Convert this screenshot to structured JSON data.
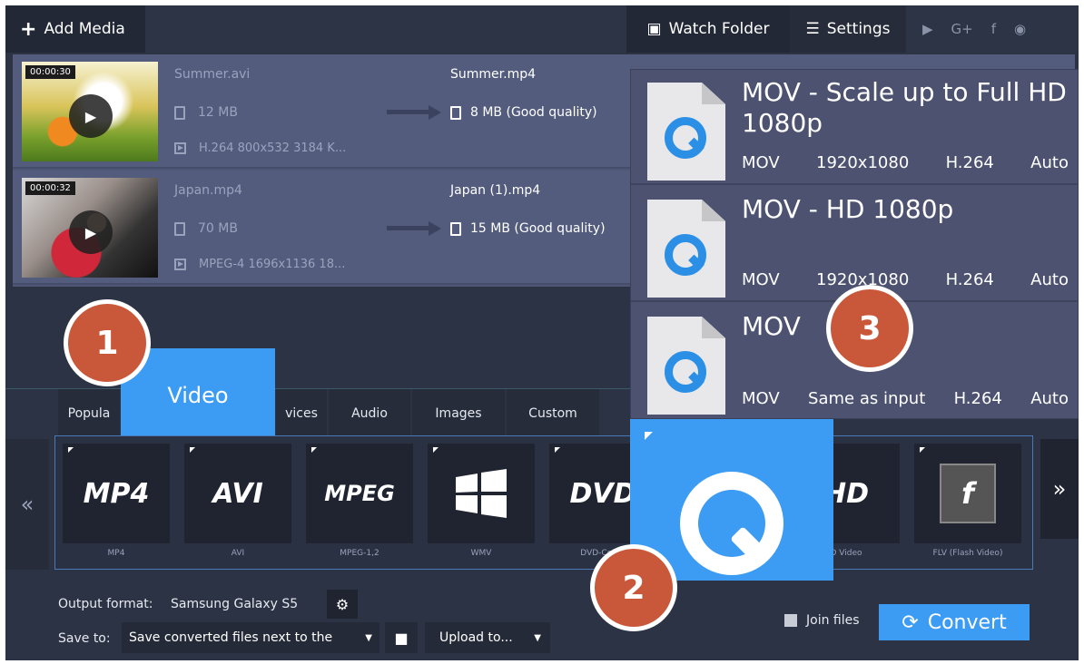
{
  "toolbar": {
    "add_media": "Add Media",
    "watch_folder": "Watch Folder",
    "settings": "Settings",
    "social": [
      "youtube",
      "G+",
      "f",
      "other"
    ]
  },
  "files": [
    {
      "duration": "00:00:30",
      "name": "Summer.avi",
      "size": "12 MB",
      "codec": "H.264 800x532 3184 K...",
      "output_name": "Summer.mp4",
      "output_size": "8 MB (Good quality)"
    },
    {
      "duration": "00:00:32",
      "name": "Japan.mp4",
      "size": "70 MB",
      "codec": "MPEG-4 1696x1136 18...",
      "output_name": "Japan (1).mp4",
      "output_size": "15 MB (Good quality)"
    }
  ],
  "dropdown": [
    {
      "title": "MOV - Scale up to Full HD 1080p",
      "specs": [
        "MOV",
        "1920x1080",
        "H.264",
        "Auto"
      ]
    },
    {
      "title": "MOV - HD 1080p",
      "specs": [
        "MOV",
        "1920x1080",
        "H.264",
        "Auto"
      ]
    },
    {
      "title": "MOV",
      "specs": [
        "MOV",
        "Same as input",
        "H.264",
        "Auto"
      ]
    }
  ],
  "tabs": {
    "popular": "Popula",
    "video": "Video",
    "devices": "vices",
    "audio": "Audio",
    "images": "Images",
    "custom": "Custom"
  },
  "formats": [
    {
      "logo": "MP4",
      "label": "MP4"
    },
    {
      "logo": "AVI",
      "label": "AVI"
    },
    {
      "logo": "MPEG",
      "label": "MPEG-1,2"
    },
    {
      "logo": "",
      "label": "WMV"
    },
    {
      "logo": "DVD",
      "label": "DVD-Comp"
    },
    {
      "logo": "HD",
      "label": "D Video"
    },
    {
      "logo": "f",
      "label": "FLV (Flash Video)"
    }
  ],
  "nav": {
    "prev": "«",
    "next": "»"
  },
  "bottom": {
    "output_label": "Output format:",
    "output_value": "Samsung Galaxy S5",
    "save_label": "Save to:",
    "save_value": "Save converted files next to the",
    "upload": "Upload to...",
    "join": "Join files",
    "convert": "Convert"
  },
  "markers": [
    "1",
    "2",
    "3"
  ],
  "colors": {
    "accent": "#3c9bf2",
    "marker": "#c9583a"
  }
}
